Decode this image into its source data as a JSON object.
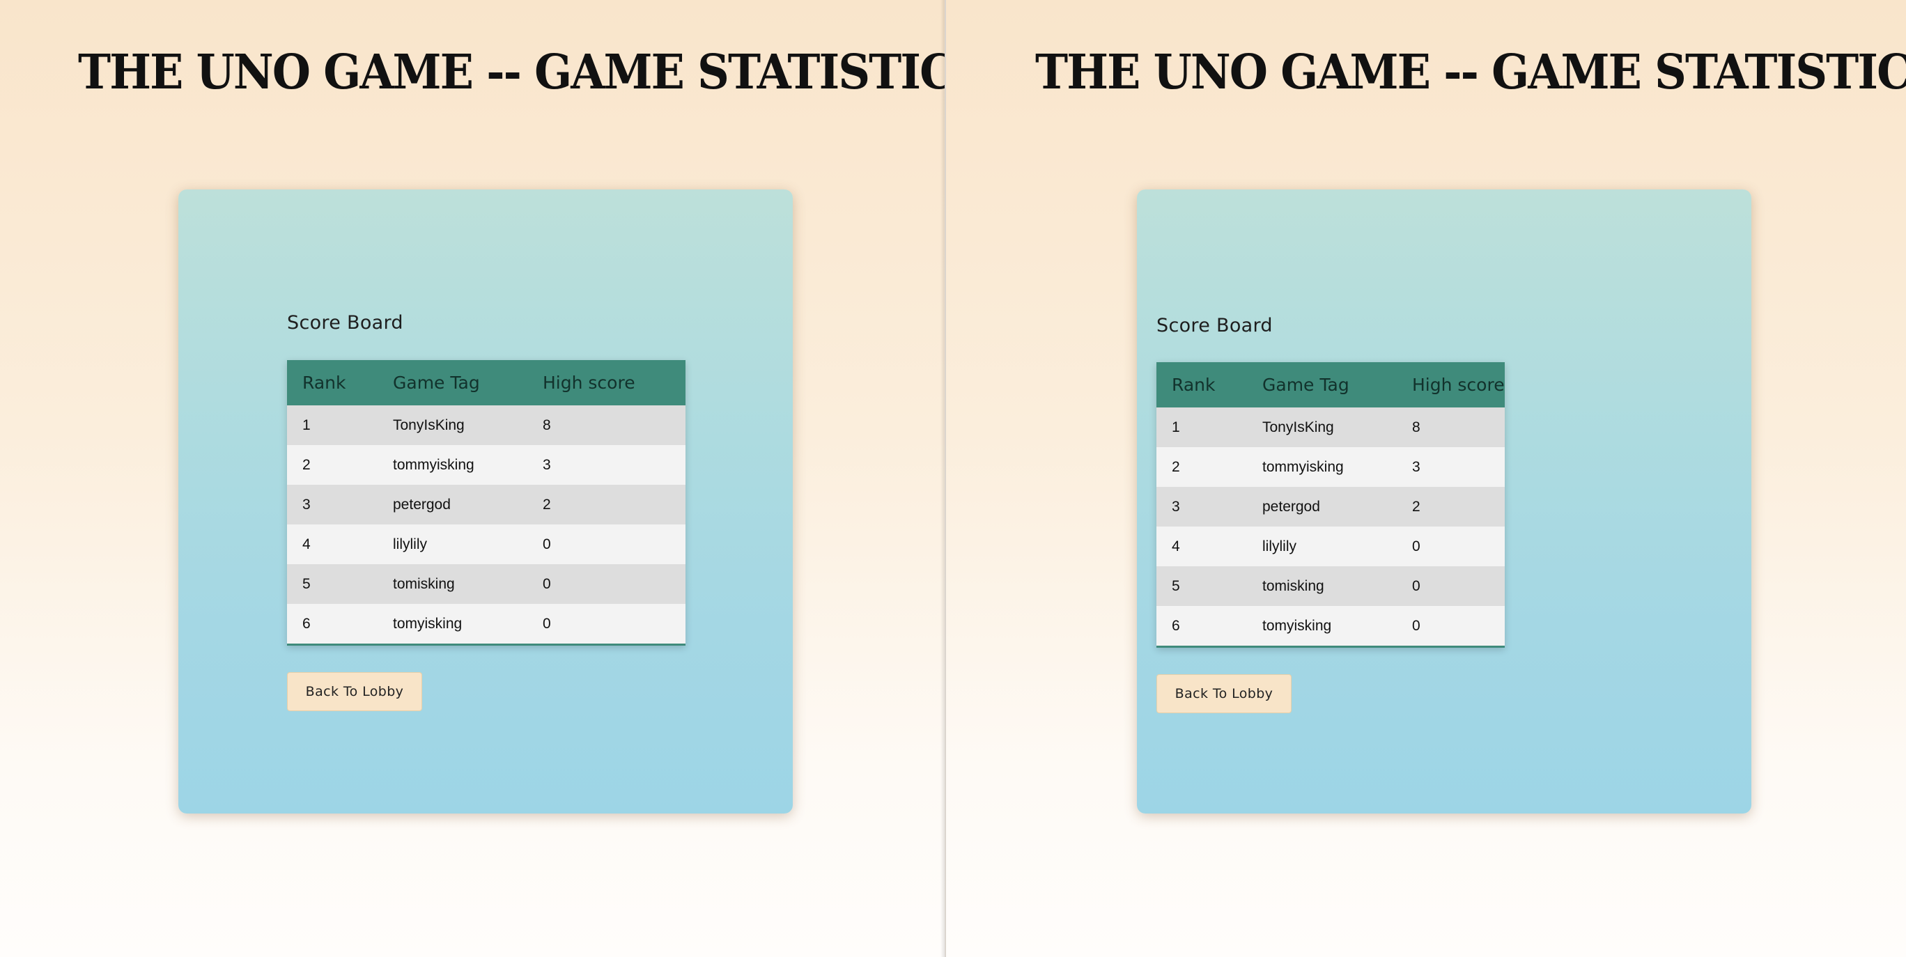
{
  "page": {
    "title": "THE UNO GAME -- GAME STATISTICS"
  },
  "scoreboard": {
    "title": "Score Board",
    "columns": [
      "Rank",
      "Game Tag",
      "High score"
    ],
    "rows": [
      {
        "rank": "1",
        "tag": "TonyIsKing",
        "score": "8"
      },
      {
        "rank": "2",
        "tag": "tommyisking",
        "score": "3"
      },
      {
        "rank": "3",
        "tag": "petergod",
        "score": "2"
      },
      {
        "rank": "4",
        "tag": "lilylily",
        "score": "0"
      },
      {
        "rank": "5",
        "tag": "tomisking",
        "score": "0"
      },
      {
        "rank": "6",
        "tag": "tomyisking",
        "score": "0"
      }
    ]
  },
  "actions": {
    "back_label": "Back To Lobby"
  },
  "colors": {
    "header_bg": "#3f8b7b",
    "card_top": "#bde0da",
    "card_bottom": "#9dd5e6",
    "button_bg": "#f8e4c8",
    "page_bg_top": "#f9e5cb"
  }
}
